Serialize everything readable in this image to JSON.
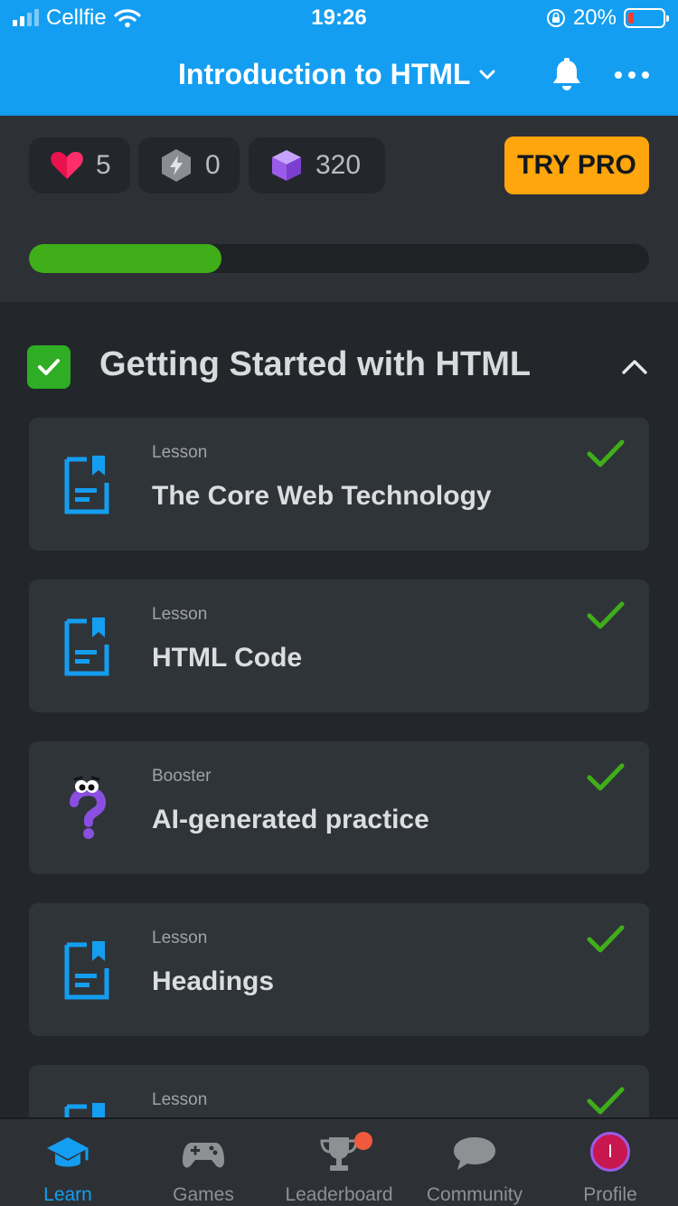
{
  "status_bar": {
    "carrier": "Cellfie",
    "time": "19:26",
    "battery_percent": "20%",
    "battery_level": 0.2
  },
  "nav": {
    "title": "Introduction to HTML",
    "icons": [
      "chevron-down-icon",
      "bell-icon",
      "more-icon"
    ]
  },
  "stats": {
    "hearts": "5",
    "energy": "0",
    "gems": "320",
    "try_pro": "TRY PRO"
  },
  "progress": {
    "fraction": 0.31,
    "color": "#3fae19"
  },
  "section": {
    "title": "Getting Started with HTML",
    "completed": true
  },
  "lessons": [
    {
      "type": "Lesson",
      "title": "The Core Web Technology",
      "icon": "lesson-document-icon",
      "completed": true
    },
    {
      "type": "Lesson",
      "title": "HTML Code",
      "icon": "lesson-document-icon",
      "completed": true
    },
    {
      "type": "Booster",
      "title": "AI-generated practice",
      "icon": "question-mascot-icon",
      "completed": true
    },
    {
      "type": "Lesson",
      "title": "Headings",
      "icon": "lesson-document-icon",
      "completed": true
    },
    {
      "type": "Lesson",
      "title": "",
      "icon": "lesson-document-icon",
      "completed": true
    }
  ],
  "tabs": [
    {
      "label": "Learn",
      "icon": "graduation-cap-icon",
      "active": true
    },
    {
      "label": "Games",
      "icon": "gamepad-icon",
      "active": false
    },
    {
      "label": "Leaderboard",
      "icon": "trophy-icon",
      "active": false,
      "badge": true
    },
    {
      "label": "Community",
      "icon": "chat-bubble-icon",
      "active": false
    },
    {
      "label": "Profile",
      "icon": "avatar",
      "active": false,
      "avatar_initial": "I"
    }
  ],
  "colors": {
    "brand_blue": "#149ef1",
    "accent_orange": "#ffa50d",
    "success_green": "#3fae19",
    "heart_red": "#e8124f",
    "gem_purple": "#9a5be8"
  }
}
